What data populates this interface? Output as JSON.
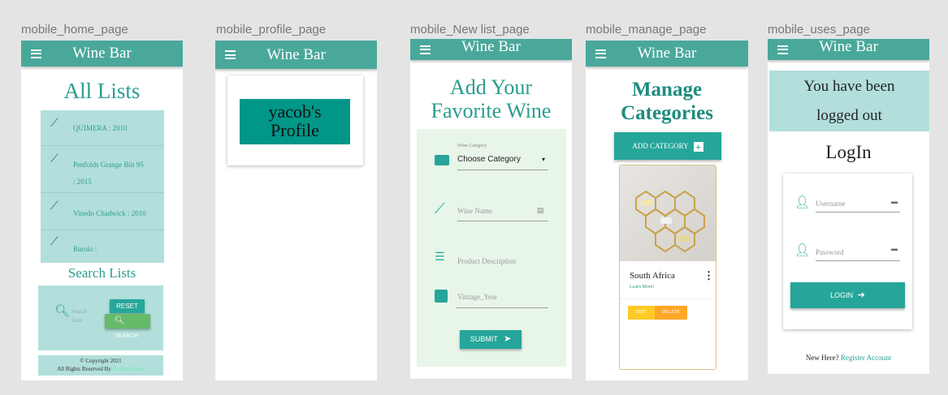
{
  "frames": {
    "home": "mobile_home_page",
    "profile": "mobile_profile_page",
    "newlist": "mobile_New list_page",
    "manage": "mobile_manage_page",
    "uses": "mobile_uses_page"
  },
  "app_title": "Wine Bar",
  "home": {
    "heading": "All Lists",
    "items": [
      "QUIMERA  : 2010",
      "Penfolds Grange Bin 95",
      ": 2015",
      "Vinedo Chadwick  : 2010",
      "Barolo  :"
    ],
    "search_heading": "Search Lists",
    "search_placeholder": "Search Lists",
    "reset_label": "RESET",
    "search_label": "SEARCH",
    "copyright": "© Copyright 2021",
    "rights_prefix": "All Rights Reserved By",
    "rights_name": "Yoolina Desta"
  },
  "profile": {
    "title_line1": "yacob's",
    "title_line2": "Profile"
  },
  "newlist": {
    "heading_line1": "Add Your",
    "heading_line2": "Favorite Wine",
    "category_label": "Wine Category",
    "category_value": "Choose Category",
    "wine_name_placeholder": "Wine Name",
    "description_placeholder": "Product Description",
    "year_placeholder": "Vintage_Year",
    "submit_label": "SUBMIT"
  },
  "manage": {
    "heading_line1": "Manage",
    "heading_line2": "Categories",
    "add_label": "ADD CATEGORY",
    "card_title": "South Africa",
    "card_link": "Learn More!",
    "edit_label": "EDIT",
    "delete_label": "DELETE"
  },
  "uses": {
    "logout_line1": "You have been",
    "logout_line2": "logged out",
    "login_heading": "LogIn",
    "username_placeholder": "Username",
    "password_placeholder": "Password",
    "login_label": "LOGIN",
    "new_here": "New Here?",
    "register_link": "Register Account"
  }
}
